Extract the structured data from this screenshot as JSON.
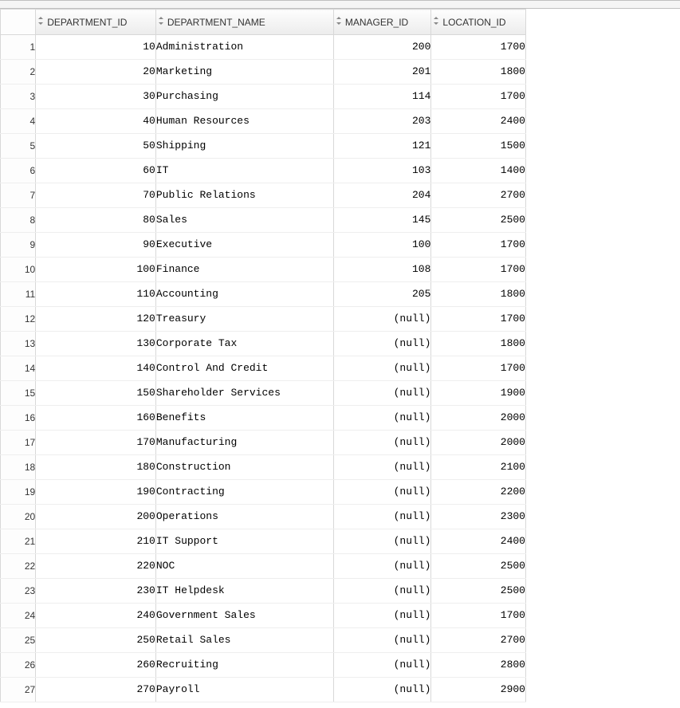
{
  "null_display": "(null)",
  "columns": [
    {
      "key": "DEPARTMENT_ID",
      "label": "DEPARTMENT_ID",
      "align": "right"
    },
    {
      "key": "DEPARTMENT_NAME",
      "label": "DEPARTMENT_NAME",
      "align": "left"
    },
    {
      "key": "MANAGER_ID",
      "label": "MANAGER_ID",
      "align": "right"
    },
    {
      "key": "LOCATION_ID",
      "label": "LOCATION_ID",
      "align": "right"
    }
  ],
  "rows": [
    {
      "DEPARTMENT_ID": 10,
      "DEPARTMENT_NAME": "Administration",
      "MANAGER_ID": 200,
      "LOCATION_ID": 1700
    },
    {
      "DEPARTMENT_ID": 20,
      "DEPARTMENT_NAME": "Marketing",
      "MANAGER_ID": 201,
      "LOCATION_ID": 1800
    },
    {
      "DEPARTMENT_ID": 30,
      "DEPARTMENT_NAME": "Purchasing",
      "MANAGER_ID": 114,
      "LOCATION_ID": 1700
    },
    {
      "DEPARTMENT_ID": 40,
      "DEPARTMENT_NAME": "Human Resources",
      "MANAGER_ID": 203,
      "LOCATION_ID": 2400
    },
    {
      "DEPARTMENT_ID": 50,
      "DEPARTMENT_NAME": "Shipping",
      "MANAGER_ID": 121,
      "LOCATION_ID": 1500
    },
    {
      "DEPARTMENT_ID": 60,
      "DEPARTMENT_NAME": "IT",
      "MANAGER_ID": 103,
      "LOCATION_ID": 1400
    },
    {
      "DEPARTMENT_ID": 70,
      "DEPARTMENT_NAME": "Public Relations",
      "MANAGER_ID": 204,
      "LOCATION_ID": 2700
    },
    {
      "DEPARTMENT_ID": 80,
      "DEPARTMENT_NAME": "Sales",
      "MANAGER_ID": 145,
      "LOCATION_ID": 2500
    },
    {
      "DEPARTMENT_ID": 90,
      "DEPARTMENT_NAME": "Executive",
      "MANAGER_ID": 100,
      "LOCATION_ID": 1700
    },
    {
      "DEPARTMENT_ID": 100,
      "DEPARTMENT_NAME": "Finance",
      "MANAGER_ID": 108,
      "LOCATION_ID": 1700
    },
    {
      "DEPARTMENT_ID": 110,
      "DEPARTMENT_NAME": "Accounting",
      "MANAGER_ID": 205,
      "LOCATION_ID": 1800
    },
    {
      "DEPARTMENT_ID": 120,
      "DEPARTMENT_NAME": "Treasury",
      "MANAGER_ID": null,
      "LOCATION_ID": 1700
    },
    {
      "DEPARTMENT_ID": 130,
      "DEPARTMENT_NAME": "Corporate Tax",
      "MANAGER_ID": null,
      "LOCATION_ID": 1800
    },
    {
      "DEPARTMENT_ID": 140,
      "DEPARTMENT_NAME": "Control And Credit",
      "MANAGER_ID": null,
      "LOCATION_ID": 1700
    },
    {
      "DEPARTMENT_ID": 150,
      "DEPARTMENT_NAME": "Shareholder Services",
      "MANAGER_ID": null,
      "LOCATION_ID": 1900
    },
    {
      "DEPARTMENT_ID": 160,
      "DEPARTMENT_NAME": "Benefits",
      "MANAGER_ID": null,
      "LOCATION_ID": 2000
    },
    {
      "DEPARTMENT_ID": 170,
      "DEPARTMENT_NAME": "Manufacturing",
      "MANAGER_ID": null,
      "LOCATION_ID": 2000
    },
    {
      "DEPARTMENT_ID": 180,
      "DEPARTMENT_NAME": "Construction",
      "MANAGER_ID": null,
      "LOCATION_ID": 2100
    },
    {
      "DEPARTMENT_ID": 190,
      "DEPARTMENT_NAME": "Contracting",
      "MANAGER_ID": null,
      "LOCATION_ID": 2200
    },
    {
      "DEPARTMENT_ID": 200,
      "DEPARTMENT_NAME": "Operations",
      "MANAGER_ID": null,
      "LOCATION_ID": 2300
    },
    {
      "DEPARTMENT_ID": 210,
      "DEPARTMENT_NAME": "IT Support",
      "MANAGER_ID": null,
      "LOCATION_ID": 2400
    },
    {
      "DEPARTMENT_ID": 220,
      "DEPARTMENT_NAME": "NOC",
      "MANAGER_ID": null,
      "LOCATION_ID": 2500
    },
    {
      "DEPARTMENT_ID": 230,
      "DEPARTMENT_NAME": "IT Helpdesk",
      "MANAGER_ID": null,
      "LOCATION_ID": 2500
    },
    {
      "DEPARTMENT_ID": 240,
      "DEPARTMENT_NAME": "Government Sales",
      "MANAGER_ID": null,
      "LOCATION_ID": 1700
    },
    {
      "DEPARTMENT_ID": 250,
      "DEPARTMENT_NAME": "Retail Sales",
      "MANAGER_ID": null,
      "LOCATION_ID": 2700
    },
    {
      "DEPARTMENT_ID": 260,
      "DEPARTMENT_NAME": "Recruiting",
      "MANAGER_ID": null,
      "LOCATION_ID": 2800
    },
    {
      "DEPARTMENT_ID": 270,
      "DEPARTMENT_NAME": "Payroll",
      "MANAGER_ID": null,
      "LOCATION_ID": 2900
    }
  ]
}
